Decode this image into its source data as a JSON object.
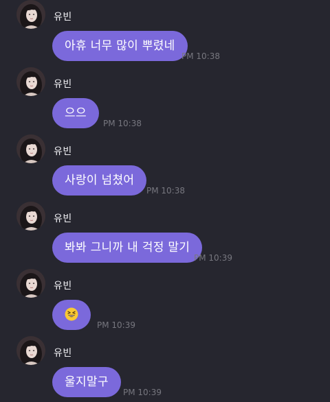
{
  "sender_name": "유빈",
  "messages": [
    {
      "text": "아휴 너무 많이 뿌렸네",
      "time": "PM 10:38"
    },
    {
      "text": "으으",
      "time": "PM 10:38"
    },
    {
      "text": "사랑이 넘쳤어",
      "time": "PM 10:38"
    },
    {
      "text": "봐봐 그니까 내 걱정 말기",
      "time": "PM 10:39"
    },
    {
      "text": "",
      "emoji": "grinning-squinting-face",
      "time": "PM 10:39"
    },
    {
      "text": "울지말구",
      "time": "PM 10:39"
    }
  ],
  "colors": {
    "background": "#26262f",
    "bubble": "#7b69db",
    "timestamp": "#77777f"
  }
}
